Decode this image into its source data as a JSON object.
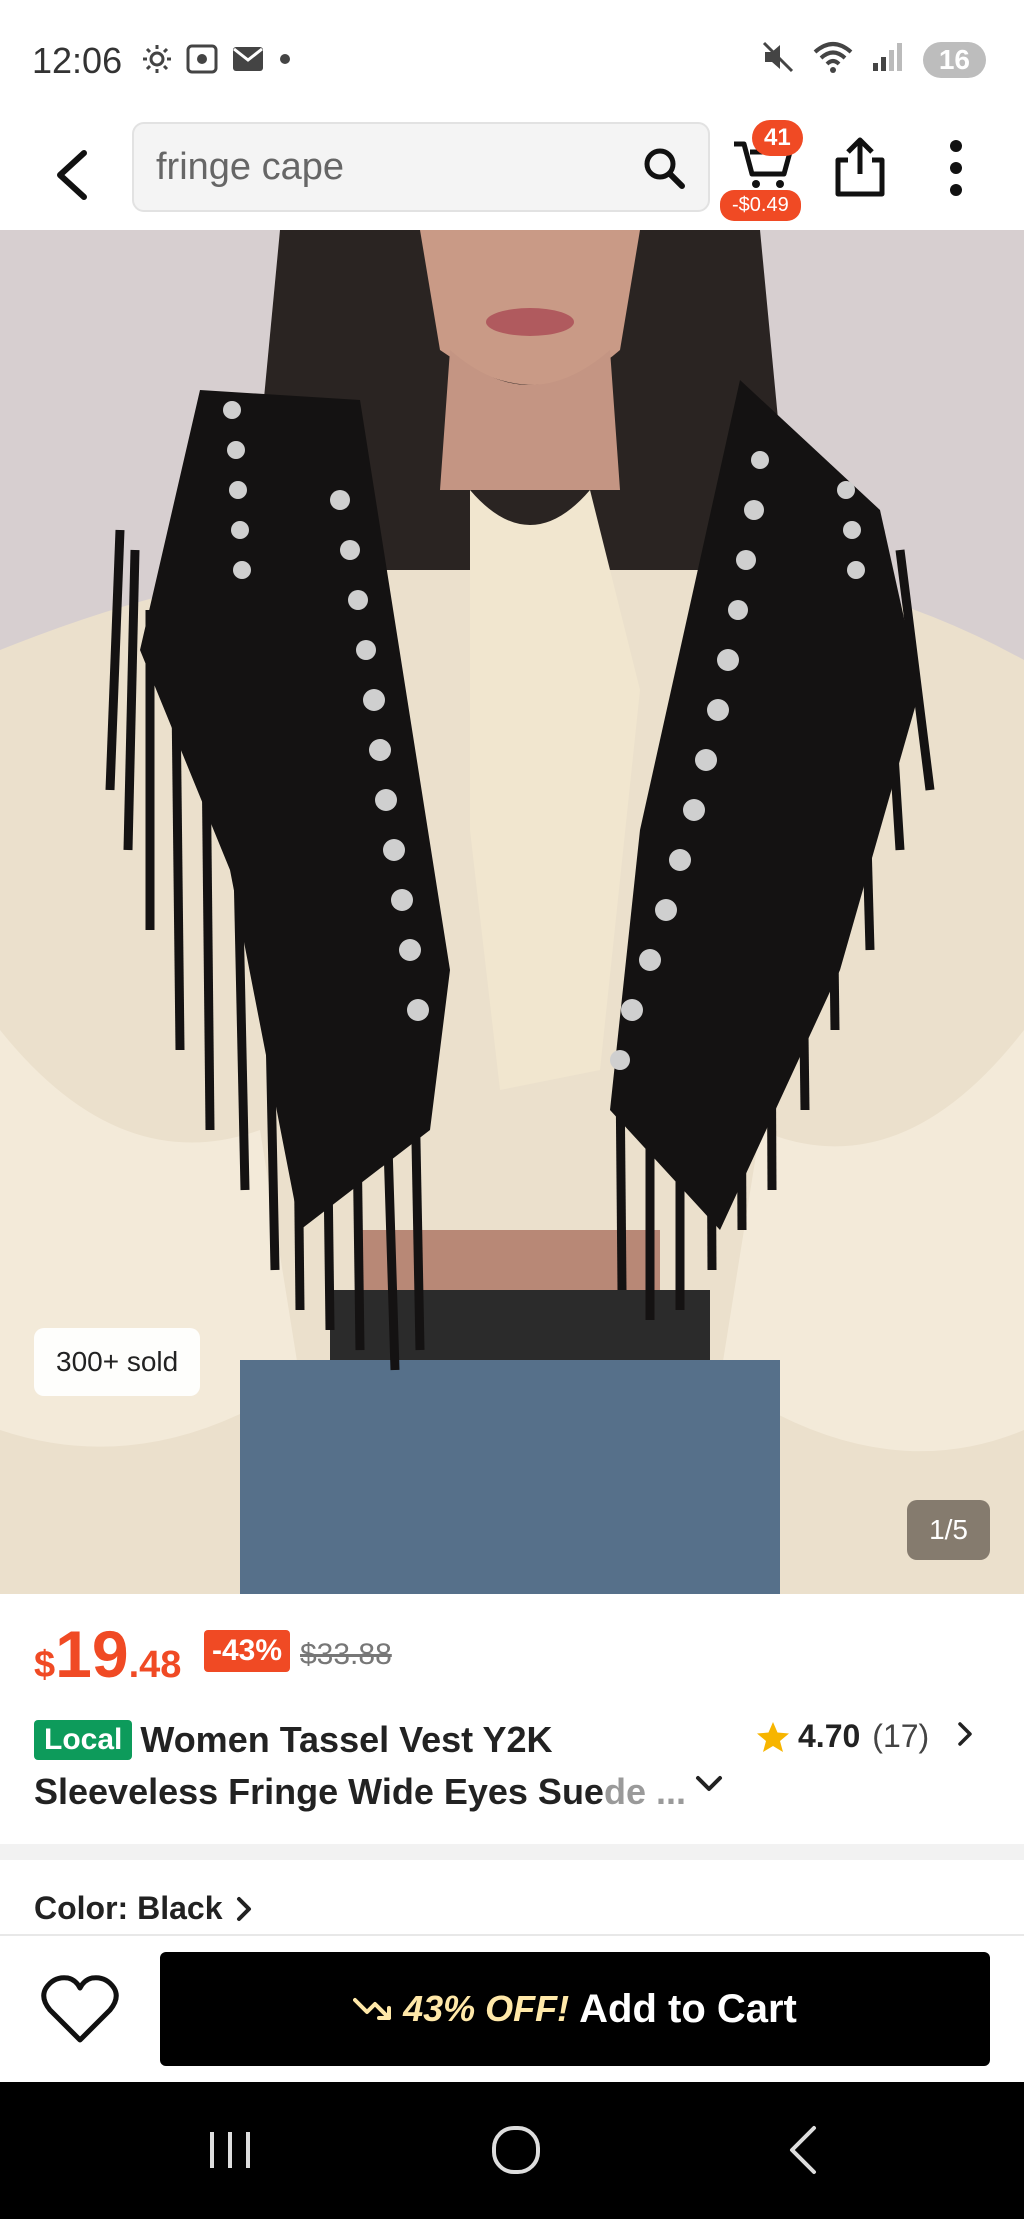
{
  "status_bar": {
    "time": "12:06",
    "battery": "16",
    "left_icons": [
      "brightness-icon",
      "screenshot-icon",
      "mail-icon",
      "dot-icon"
    ],
    "right_icons": [
      "mute-icon",
      "wifi-icon",
      "signal-icon"
    ]
  },
  "header": {
    "search_value": "fringe cape",
    "cart_count": "41",
    "cart_discount": "-$0.49"
  },
  "gallery": {
    "sold_badge": "300+ sold",
    "page_indicator": "1/5"
  },
  "product": {
    "price_currency": "$",
    "price_int": "19",
    "price_dec": ".48",
    "discount": "-43%",
    "original_price": "$33.88",
    "local_tag": "Local",
    "title_main": "Women Tassel Vest Y2K Sleeveless Fringe Wide Eyes Sue",
    "title_fade": "de ...",
    "rating_score": "4.70",
    "rating_count": "(17)",
    "color_label": "Color: Black"
  },
  "bottom": {
    "promo": "43% OFF!",
    "add_to_cart_label": "Add to Cart"
  },
  "colors": {
    "accent": "#f04a24",
    "local_green": "#0d9b5b",
    "star": "#f7b500"
  }
}
